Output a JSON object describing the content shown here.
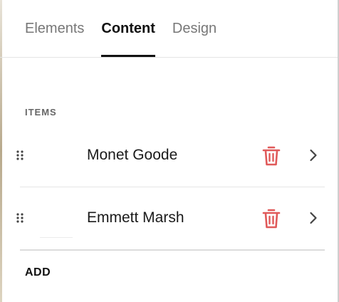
{
  "tabs": [
    {
      "label": "Elements",
      "active": false
    },
    {
      "label": "Content",
      "active": true
    },
    {
      "label": "Design",
      "active": false
    }
  ],
  "section": {
    "label": "ITEMS"
  },
  "items": [
    {
      "name": "Monet Goode"
    },
    {
      "name": "Emmett Marsh"
    }
  ],
  "actions": {
    "add_label": "ADD"
  },
  "colors": {
    "delete_icon": "#e05a5a",
    "active_tab": "#111111",
    "inactive_tab": "#777777"
  }
}
